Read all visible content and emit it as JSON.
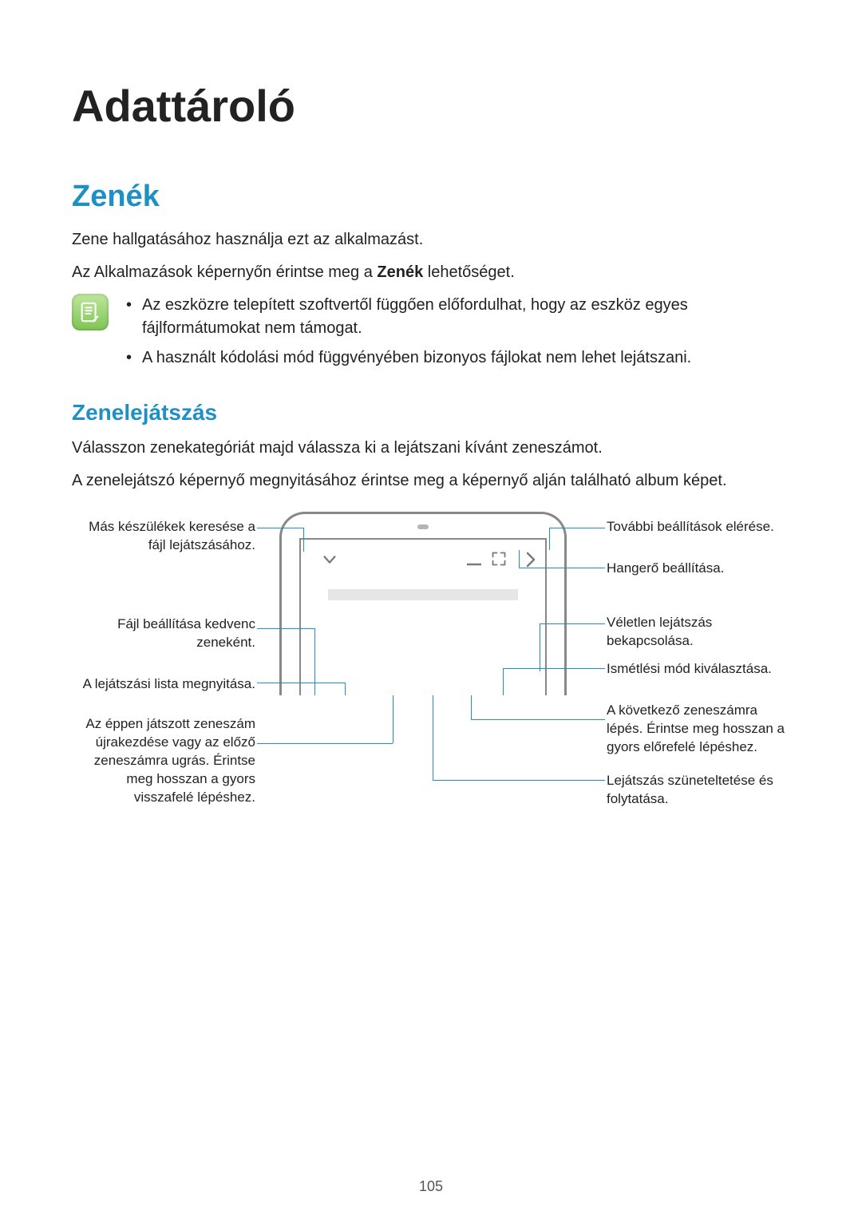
{
  "page_title": "Adattároló",
  "section1_title": "Zenék",
  "intro1": "Zene hallgatásához használja ezt az alkalmazást.",
  "intro2_pre": "Az Alkalmazások képernyőn érintse meg a ",
  "intro2_bold": "Zenék",
  "intro2_post": " lehetőséget.",
  "note_bullets": [
    "Az eszközre telepített szoftvertől függően előfordulhat, hogy az eszköz egyes fájlformátumokat nem támogat.",
    "A használt kódolási mód függvényében bizonyos fájlokat nem lehet lejátszani."
  ],
  "subsection_title": "Zenelejátszás",
  "para_a": "Válasszon zenekategóriát majd válassza ki a lejátszani kívánt zeneszámot.",
  "para_b": "A zenelejátszó képernyő megnyitásához érintse meg a képernyő alján található album képet.",
  "labels": {
    "left": {
      "a": "Más készülékek keresése a fájl lejátszásához.",
      "b": "Fájl beállítása kedvenc zeneként.",
      "c": "A lejátszási lista megnyitása.",
      "d": "Az éppen játszott zeneszám újrakezdése vagy az előző zeneszámra ugrás. Érintse meg hosszan a gyors visszafelé lépéshez."
    },
    "right": {
      "e": "További beállítások elérése.",
      "f": "Hangerő beállítása.",
      "g": "Véletlen lejátszás bekapcsolása.",
      "h": "Ismétlési mód kiválasztása.",
      "i": "A következő zeneszámra lépés. Érintse meg hosszan a gyors előrefelé lépéshez.",
      "j": "Lejátszás szüneteltetése és folytatása."
    }
  },
  "page_number": "105"
}
